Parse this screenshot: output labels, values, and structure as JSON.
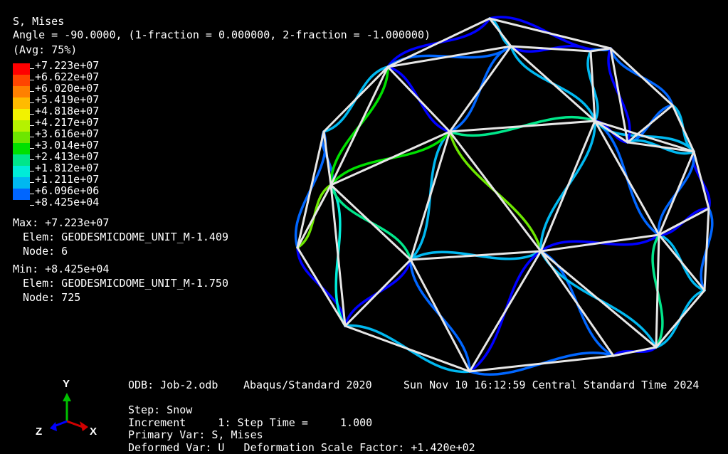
{
  "legend": {
    "title": "S, Mises",
    "angle": "Angle = -90.0000, (1-fraction = 0.000000, 2-fraction = -1.000000)",
    "avg": "(Avg: 75%)",
    "entries": [
      {
        "value": "+7.223e+07",
        "color": "#ff0000"
      },
      {
        "value": "+6.622e+07",
        "color": "#ff4500"
      },
      {
        "value": "+6.020e+07",
        "color": "#ff8000"
      },
      {
        "value": "+5.419e+07",
        "color": "#ffbb00"
      },
      {
        "value": "+4.818e+07",
        "color": "#f2f200"
      },
      {
        "value": "+4.217e+07",
        "color": "#b5f200"
      },
      {
        "value": "+3.616e+07",
        "color": "#6de600"
      },
      {
        "value": "+3.014e+07",
        "color": "#00e000"
      },
      {
        "value": "+2.413e+07",
        "color": "#00e68a"
      },
      {
        "value": "+1.812e+07",
        "color": "#00ecd8"
      },
      {
        "value": "+1.211e+07",
        "color": "#00b8f0"
      },
      {
        "value": "+6.096e+06",
        "color": "#0066ff"
      },
      {
        "value": "+8.425e+04",
        "color": "#0000ff"
      }
    ]
  },
  "extremes": {
    "max_line": "Max: +7.223e+07",
    "max_elem": "Elem: GEODESMICDOME_UNIT_M-1.409",
    "max_node": "Node: 6",
    "min_line": "Min: +8.425e+04",
    "min_elem": "Elem: GEODESMICDOME_UNIT_M-1.750",
    "min_node": "Node: 725"
  },
  "info": {
    "odb": "ODB: Job-2.odb",
    "solver": "Abaqus/Standard 2020",
    "date": "Sun Nov 10 16:12:59 Central Standard Time 2024",
    "step": "Step: Snow",
    "increment": "Increment     1: Step Time =     1.000",
    "primary": "Primary Var: S, Mises",
    "deformed": "Deformed Var: U   Deformation Scale Factor: +1.420e+02"
  },
  "triad": {
    "y": "Y",
    "z": "Z",
    "x": "X"
  },
  "colors": {
    "background": "#000000",
    "undeformed": "#e6e6e6",
    "stress_low": "#0000ff"
  }
}
